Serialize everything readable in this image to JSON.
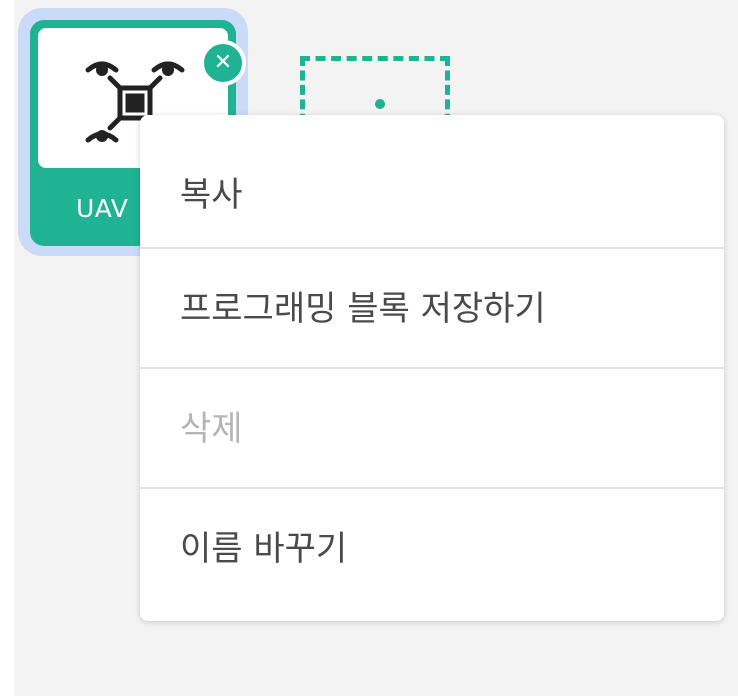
{
  "object": {
    "name": "UAV",
    "icon": "drone-icon",
    "close_icon": "close-icon",
    "close_glyph": "✕"
  },
  "add_object": {
    "icon": "add-object-placeholder"
  },
  "context_menu": {
    "items": [
      {
        "label": "복사",
        "enabled": true
      },
      {
        "label": "프로그래밍 블록 저장하기",
        "enabled": true
      },
      {
        "label": "삭제",
        "enabled": false
      },
      {
        "label": "이름 바꾸기",
        "enabled": true
      }
    ]
  },
  "colors": {
    "accent": "#1fb394",
    "selection": "#c9dbf8",
    "background": "#f3f3f3",
    "menu_text": "#4a4a4a",
    "menu_text_disabled": "#b5b5b5"
  }
}
